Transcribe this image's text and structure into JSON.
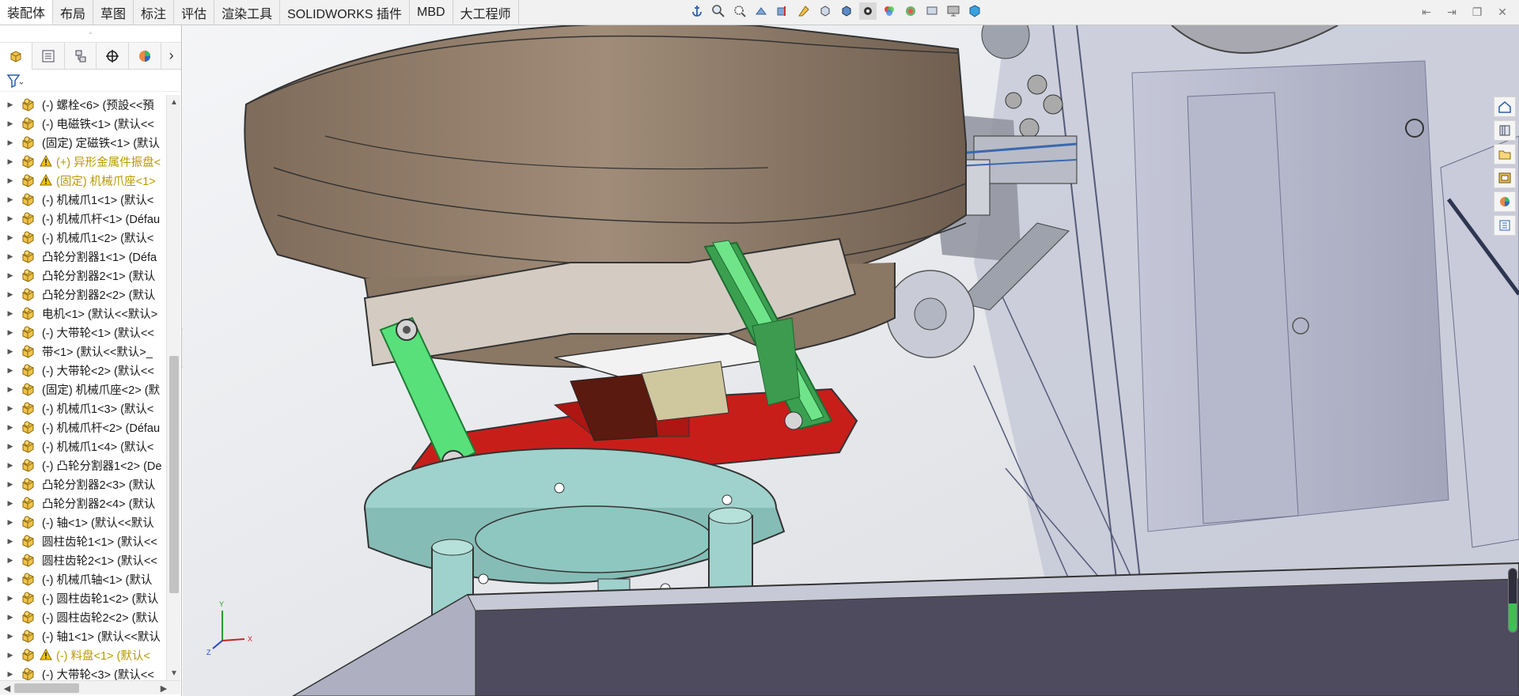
{
  "tabs": [
    "装配体",
    "布局",
    "草图",
    "标注",
    "评估",
    "渲染工具",
    "SOLIDWORKS 插件",
    "MBD",
    "大工程师"
  ],
  "active_tab": "装配体",
  "hud_icons": [
    "anchor-icon",
    "zoom-fit-icon",
    "zoom-area-icon",
    "previous-view-icon",
    "section-view-icon",
    "dynamic-annotation-icon",
    "view-orientation-icon",
    "display-style-icon",
    "hide-show-icon",
    "edit-appearance-icon",
    "apply-scene-icon",
    "view-settings-icon",
    "monitor-icon",
    "cube-icon"
  ],
  "panel_tabs": [
    "featuremanager-tab",
    "propertymanager-tab",
    "configurationmanager-tab",
    "dimxpert-tab",
    "displaymanager-tab"
  ],
  "tree": [
    {
      "label": "(-) 螺栓<6> (预設<<預",
      "warn": false
    },
    {
      "label": "(-) 电磁铁<1> (默认<<",
      "warn": false
    },
    {
      "label": "(固定) 定磁铁<1> (默认",
      "warn": false
    },
    {
      "label": "(+) 异形金属件振盘<",
      "warn": true
    },
    {
      "label": "(固定) 机械爪座<1>",
      "warn": true
    },
    {
      "label": "(-) 机械爪1<1> (默认<",
      "warn": false
    },
    {
      "label": "(-) 机械爪杆<1> (Défau",
      "warn": false
    },
    {
      "label": "(-) 机械爪1<2> (默认<",
      "warn": false
    },
    {
      "label": "凸轮分割器1<1> (Défa",
      "warn": false
    },
    {
      "label": "凸轮分割器2<1> (默认",
      "warn": false
    },
    {
      "label": "凸轮分割器2<2> (默认",
      "warn": false
    },
    {
      "label": "电机<1> (默认<<默认>",
      "warn": false
    },
    {
      "label": "(-) 大带轮<1> (默认<<",
      "warn": false
    },
    {
      "label": "带<1> (默认<<默认>_",
      "warn": false
    },
    {
      "label": "(-) 大带轮<2> (默认<<",
      "warn": false
    },
    {
      "label": "(固定) 机械爪座<2> (默",
      "warn": false
    },
    {
      "label": "(-) 机械爪1<3> (默认<",
      "warn": false
    },
    {
      "label": "(-) 机械爪杆<2> (Défau",
      "warn": false
    },
    {
      "label": "(-) 机械爪1<4> (默认<",
      "warn": false
    },
    {
      "label": "(-) 凸轮分割器1<2> (De",
      "warn": false
    },
    {
      "label": "凸轮分割器2<3> (默认",
      "warn": false
    },
    {
      "label": "凸轮分割器2<4> (默认",
      "warn": false
    },
    {
      "label": "(-) 轴<1> (默认<<默认",
      "warn": false
    },
    {
      "label": "圆柱齿轮1<1> (默认<<",
      "warn": false
    },
    {
      "label": "圆柱齿轮2<1> (默认<<",
      "warn": false
    },
    {
      "label": "(-) 机械爪轴<1> (默认",
      "warn": false
    },
    {
      "label": "(-) 圆柱齿轮1<2> (默认",
      "warn": false
    },
    {
      "label": "(-) 圆柱齿轮2<2> (默认",
      "warn": false
    },
    {
      "label": "(-) 轴1<1> (默认<<默认",
      "warn": false
    },
    {
      "label": "(-) 料盘<1> (默认<",
      "warn": true
    },
    {
      "label": "(-) 大带轮<3> (默认<<",
      "warn": false
    }
  ],
  "triad": {
    "x": "X",
    "y": "Y",
    "z": "Z"
  },
  "zoom_level": 0.45,
  "colors": {
    "accent": "#3fbf55",
    "warn_text": "#b89a00",
    "tan": "#8d7a66",
    "green": "#58e07a",
    "red": "#c81e1a",
    "teal": "#9fd2cc"
  }
}
